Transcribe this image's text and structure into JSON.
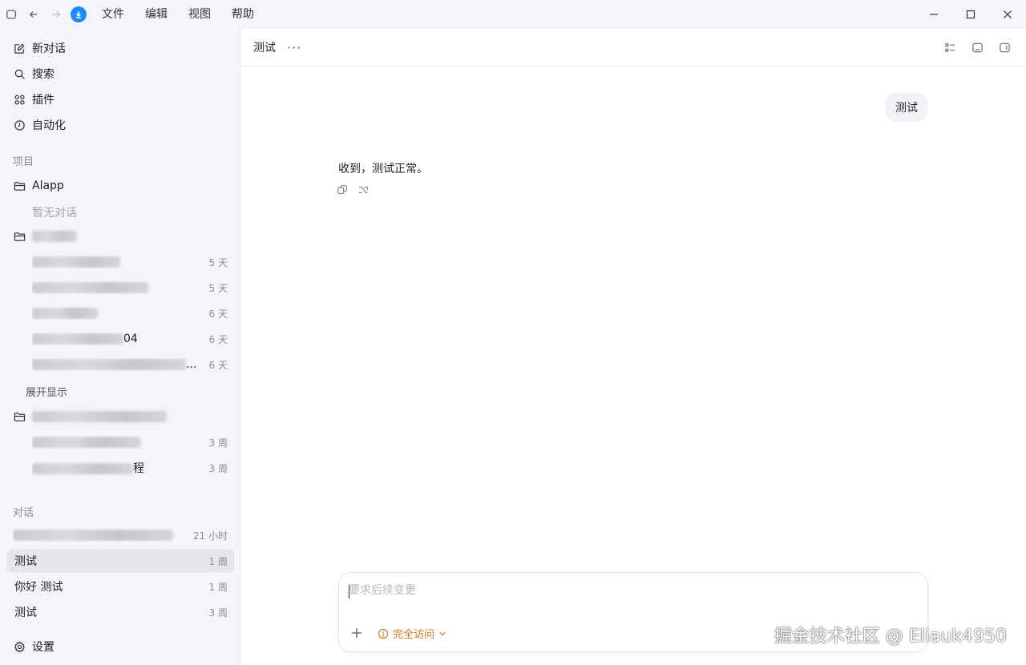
{
  "menu": {
    "file": "文件",
    "edit": "编辑",
    "view": "视图",
    "help": "帮助"
  },
  "sidebar": {
    "nav": [
      {
        "label": "新对话",
        "icon": "edit-icon"
      },
      {
        "label": "搜索",
        "icon": "search-icon"
      },
      {
        "label": "插件",
        "icon": "plugins-icon"
      },
      {
        "label": "自动化",
        "icon": "clock-icon"
      }
    ],
    "projects_label": "项目",
    "project1": {
      "name": "Alapp",
      "empty": "暂无对话"
    },
    "project2_items": [
      {
        "time": "5 天"
      },
      {
        "time": "5 天"
      },
      {
        "time": "6 天"
      },
      {
        "suffix": "04",
        "time": "6 天"
      },
      {
        "suffix": "...",
        "time": "6 天"
      }
    ],
    "expand": "展开显示",
    "project3_items": [
      {
        "time": "3 周"
      },
      {
        "suffix": "程",
        "time": "3 周"
      }
    ],
    "conversations_label": "对话",
    "conversations": [
      {
        "title": "",
        "time": "21 小时"
      },
      {
        "title": "测试",
        "time": "1 周"
      },
      {
        "title": "你好 测试",
        "time": "1 周"
      },
      {
        "title": "测试",
        "time": "3 周"
      }
    ],
    "settings": "设置"
  },
  "main": {
    "title": "测试",
    "user_message": "测试",
    "assistant_message": "收到，测试正常。"
  },
  "composer": {
    "placeholder": "要求后续变更",
    "access_label": "完全访问"
  },
  "watermark": "掘金技术社区 @ Eliauk4950",
  "colors": {
    "accent": "#1a8cff",
    "access": "#d4741a",
    "sidebar_bg": "#f4f5f8"
  }
}
